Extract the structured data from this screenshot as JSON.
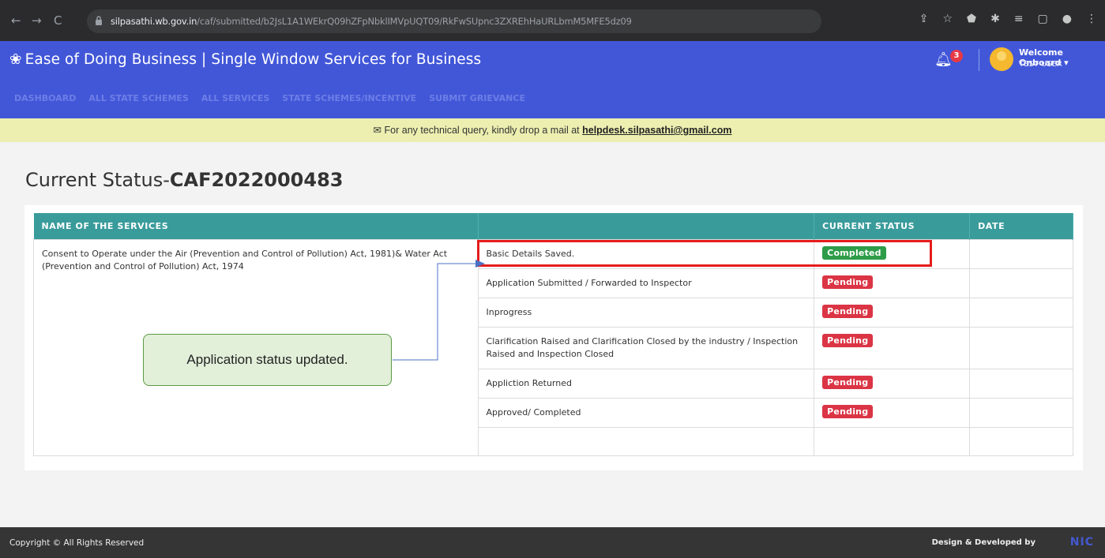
{
  "browser": {
    "url_domain": "silpasathi.wb.gov.in",
    "url_path": "/caf/submitted/b2JsL1A1WEkrQ09hZFpNbklIMVpUQT09/RkFwSUpnc3ZXREhHaURLbmM5MFE5dz09"
  },
  "header": {
    "title": "Ease of Doing Business | Single Window Services for Business",
    "notification_count": "3",
    "welcome": "Welcome Onboard",
    "user": "TEST USER"
  },
  "nav": {
    "items": [
      "DASHBOARD",
      "ALL STATE SCHEMES",
      "ALL SERVICES",
      "STATE SCHEMES/INCENTIVE",
      "SUBMIT GRIEVANCE"
    ]
  },
  "notice": {
    "text": "For any technical query, kindly drop a mail at",
    "email": "helpdesk.silpasathi@gmail.com"
  },
  "page": {
    "title_prefix": "Current Status-",
    "caf_id": "CAF2022000483"
  },
  "table": {
    "headers": [
      "NAME OF THE SERVICES",
      "",
      "CURRENT STATUS",
      "DATE"
    ],
    "service_name": "Consent to Operate under the Air (Prevention and Control of Pollution) Act, 1981)& Water Act (Prevention and Control of Pollution) Act, 1974",
    "steps": [
      {
        "label": "Basic Details Saved.",
        "status": "Completed"
      },
      {
        "label": "Application Submitted / Forwarded to Inspector",
        "status": "Pending"
      },
      {
        "label": "Inprogress",
        "status": "Pending"
      },
      {
        "label": "Clarification Raised and Clarification Closed by the industry / Inspection Raised and Inspection Closed",
        "status": "Pending"
      },
      {
        "label": "Appliction Returned",
        "status": "Pending"
      },
      {
        "label": "Approved/ Completed",
        "status": "Pending"
      }
    ]
  },
  "annotation": {
    "callout": "Application status updated."
  },
  "footer": {
    "copyright": "Copyright © All Rights Reserved",
    "developed": "Design & Developed by",
    "logo": "NIC"
  },
  "colors": {
    "header_blue": "#4257d8",
    "table_header_teal": "#3a9b9b",
    "completed_green": "#2e9c48",
    "pending_red": "#db3545",
    "notice_yellow": "#ecefb0"
  }
}
